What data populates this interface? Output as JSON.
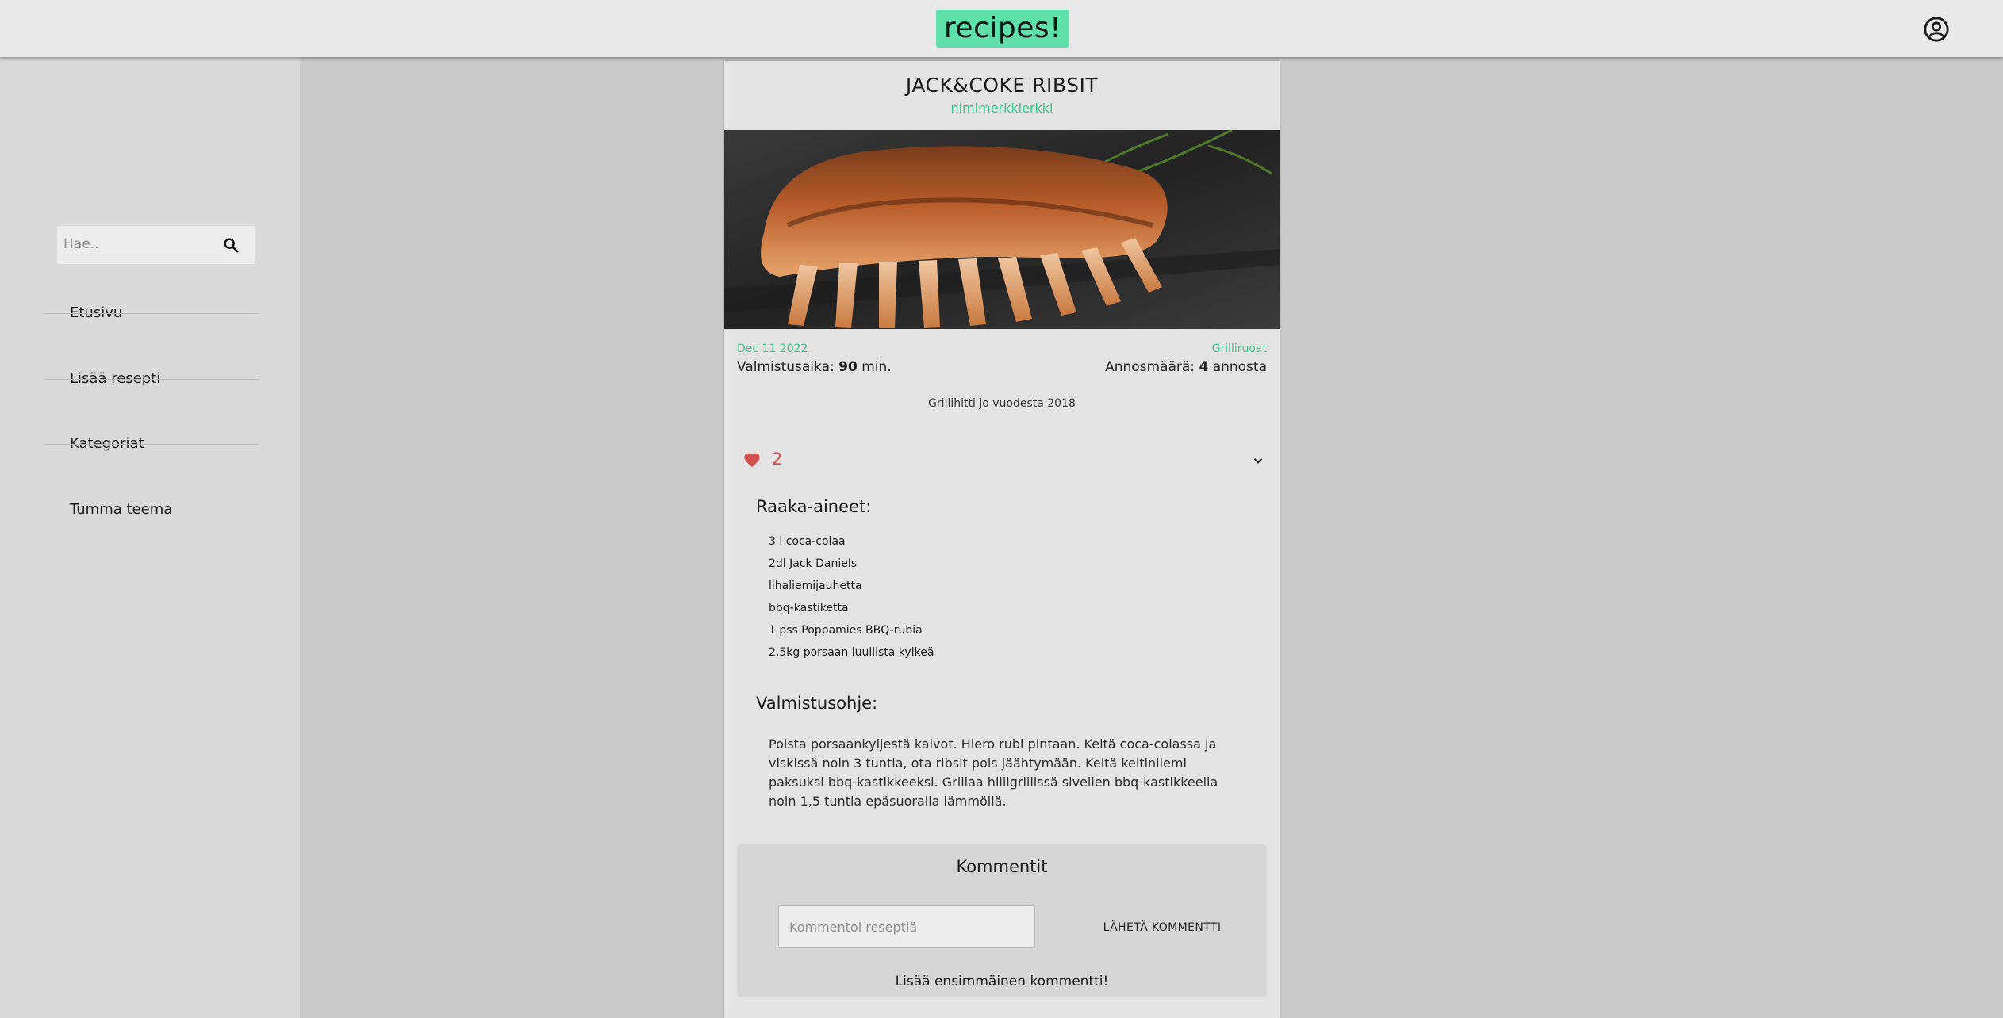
{
  "header": {
    "logo_text": "recipes!",
    "account_icon": "account-circle-icon",
    "accent_color": "#5fe0ab"
  },
  "sidebar": {
    "search": {
      "placeholder": "Hae..",
      "value": "",
      "icon": "search-icon"
    },
    "items": [
      {
        "label": "Etusivu"
      },
      {
        "label": "Lisää resepti"
      },
      {
        "label": "Kategoriat"
      },
      {
        "label": "Tumma teema"
      }
    ]
  },
  "recipe": {
    "title": "JACK&COKE RIBSIT",
    "author": "nimimerkkierkki",
    "date": "Dec 11 2022",
    "category": "Grilliruoat",
    "prep_label": "Valmistusaika:",
    "prep_time": "90",
    "prep_unit": "min.",
    "servings_label": "Annosmäärä:",
    "servings": "4",
    "servings_unit": "annosta",
    "description": "Grillihitti jo vuodesta 2018",
    "likes": "2",
    "like_color": "#d0514d",
    "link_color": "#3cc48d",
    "ingredients_heading": "Raaka-aineet:",
    "ingredients": [
      "3 l coca-colaa",
      "2dl Jack Daniels",
      "lihaliemijauhetta",
      "bbq-kastiketta",
      "1 pss Poppamies BBQ-rubia",
      "2,5kg porsaan luullista kylkeä"
    ],
    "instructions_heading": "Valmistusohje:",
    "instructions": "Poista porsaankyljestä kalvot. Hiero rubi pintaan. Keitä coca-colassa ja viskissä noin 3 tuntia, ota ribsit pois jäähtymään. Keitä keitinliemi paksuksi bbq-kastikkeeksi. Grillaa hiiligrillissä sivellen bbq-kastikkeella noin 1,5 tuntia epäsuoralla lämmöllä."
  },
  "comments": {
    "title": "Kommentit",
    "input_placeholder": "Kommentoi reseptiä",
    "input_value": "",
    "send_label": "LÄHETÄ KOMMENTTI",
    "empty_text": "Lisää ensimmäinen kommentti!"
  }
}
